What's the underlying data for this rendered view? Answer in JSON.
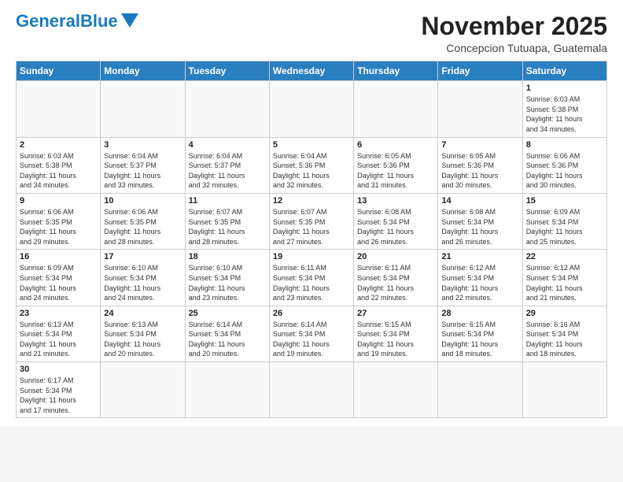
{
  "header": {
    "logo_general": "General",
    "logo_blue": "Blue",
    "month_title": "November 2025",
    "location": "Concepcion Tutuapa, Guatemala"
  },
  "weekdays": [
    "Sunday",
    "Monday",
    "Tuesday",
    "Wednesday",
    "Thursday",
    "Friday",
    "Saturday"
  ],
  "weeks": [
    [
      {
        "day": "",
        "info": ""
      },
      {
        "day": "",
        "info": ""
      },
      {
        "day": "",
        "info": ""
      },
      {
        "day": "",
        "info": ""
      },
      {
        "day": "",
        "info": ""
      },
      {
        "day": "",
        "info": ""
      },
      {
        "day": "1",
        "info": "Sunrise: 6:03 AM\nSunset: 5:38 PM\nDaylight: 11 hours\nand 34 minutes."
      }
    ],
    [
      {
        "day": "2",
        "info": "Sunrise: 6:03 AM\nSunset: 5:38 PM\nDaylight: 11 hours\nand 34 minutes."
      },
      {
        "day": "3",
        "info": "Sunrise: 6:04 AM\nSunset: 5:37 PM\nDaylight: 11 hours\nand 33 minutes."
      },
      {
        "day": "4",
        "info": "Sunrise: 6:04 AM\nSunset: 5:37 PM\nDaylight: 11 hours\nand 32 minutes."
      },
      {
        "day": "5",
        "info": "Sunrise: 6:04 AM\nSunset: 5:36 PM\nDaylight: 11 hours\nand 32 minutes."
      },
      {
        "day": "6",
        "info": "Sunrise: 6:05 AM\nSunset: 5:36 PM\nDaylight: 11 hours\nand 31 minutes."
      },
      {
        "day": "7",
        "info": "Sunrise: 6:05 AM\nSunset: 5:36 PM\nDaylight: 11 hours\nand 30 minutes."
      },
      {
        "day": "8",
        "info": "Sunrise: 6:06 AM\nSunset: 5:36 PM\nDaylight: 11 hours\nand 30 minutes."
      }
    ],
    [
      {
        "day": "9",
        "info": "Sunrise: 6:06 AM\nSunset: 5:35 PM\nDaylight: 11 hours\nand 29 minutes."
      },
      {
        "day": "10",
        "info": "Sunrise: 6:06 AM\nSunset: 5:35 PM\nDaylight: 11 hours\nand 28 minutes."
      },
      {
        "day": "11",
        "info": "Sunrise: 6:07 AM\nSunset: 5:35 PM\nDaylight: 11 hours\nand 28 minutes."
      },
      {
        "day": "12",
        "info": "Sunrise: 6:07 AM\nSunset: 5:35 PM\nDaylight: 11 hours\nand 27 minutes."
      },
      {
        "day": "13",
        "info": "Sunrise: 6:08 AM\nSunset: 5:34 PM\nDaylight: 11 hours\nand 26 minutes."
      },
      {
        "day": "14",
        "info": "Sunrise: 6:08 AM\nSunset: 5:34 PM\nDaylight: 11 hours\nand 26 minutes."
      },
      {
        "day": "15",
        "info": "Sunrise: 6:09 AM\nSunset: 5:34 PM\nDaylight: 11 hours\nand 25 minutes."
      }
    ],
    [
      {
        "day": "16",
        "info": "Sunrise: 6:09 AM\nSunset: 5:34 PM\nDaylight: 11 hours\nand 24 minutes."
      },
      {
        "day": "17",
        "info": "Sunrise: 6:10 AM\nSunset: 5:34 PM\nDaylight: 11 hours\nand 24 minutes."
      },
      {
        "day": "18",
        "info": "Sunrise: 6:10 AM\nSunset: 5:34 PM\nDaylight: 11 hours\nand 23 minutes."
      },
      {
        "day": "19",
        "info": "Sunrise: 6:11 AM\nSunset: 5:34 PM\nDaylight: 11 hours\nand 23 minutes."
      },
      {
        "day": "20",
        "info": "Sunrise: 6:11 AM\nSunset: 5:34 PM\nDaylight: 11 hours\nand 22 minutes."
      },
      {
        "day": "21",
        "info": "Sunrise: 6:12 AM\nSunset: 5:34 PM\nDaylight: 11 hours\nand 22 minutes."
      },
      {
        "day": "22",
        "info": "Sunrise: 6:12 AM\nSunset: 5:34 PM\nDaylight: 11 hours\nand 21 minutes."
      }
    ],
    [
      {
        "day": "23",
        "info": "Sunrise: 6:13 AM\nSunset: 5:34 PM\nDaylight: 11 hours\nand 21 minutes."
      },
      {
        "day": "24",
        "info": "Sunrise: 6:13 AM\nSunset: 5:34 PM\nDaylight: 11 hours\nand 20 minutes."
      },
      {
        "day": "25",
        "info": "Sunrise: 6:14 AM\nSunset: 5:34 PM\nDaylight: 11 hours\nand 20 minutes."
      },
      {
        "day": "26",
        "info": "Sunrise: 6:14 AM\nSunset: 5:34 PM\nDaylight: 11 hours\nand 19 minutes."
      },
      {
        "day": "27",
        "info": "Sunrise: 6:15 AM\nSunset: 5:34 PM\nDaylight: 11 hours\nand 19 minutes."
      },
      {
        "day": "28",
        "info": "Sunrise: 6:15 AM\nSunset: 5:34 PM\nDaylight: 11 hours\nand 18 minutes."
      },
      {
        "day": "29",
        "info": "Sunrise: 6:16 AM\nSunset: 5:34 PM\nDaylight: 11 hours\nand 18 minutes."
      }
    ],
    [
      {
        "day": "30",
        "info": "Sunrise: 6:17 AM\nSunset: 5:34 PM\nDaylight: 11 hours\nand 17 minutes."
      },
      {
        "day": "",
        "info": ""
      },
      {
        "day": "",
        "info": ""
      },
      {
        "day": "",
        "info": ""
      },
      {
        "day": "",
        "info": ""
      },
      {
        "day": "",
        "info": ""
      },
      {
        "day": "",
        "info": ""
      }
    ]
  ]
}
